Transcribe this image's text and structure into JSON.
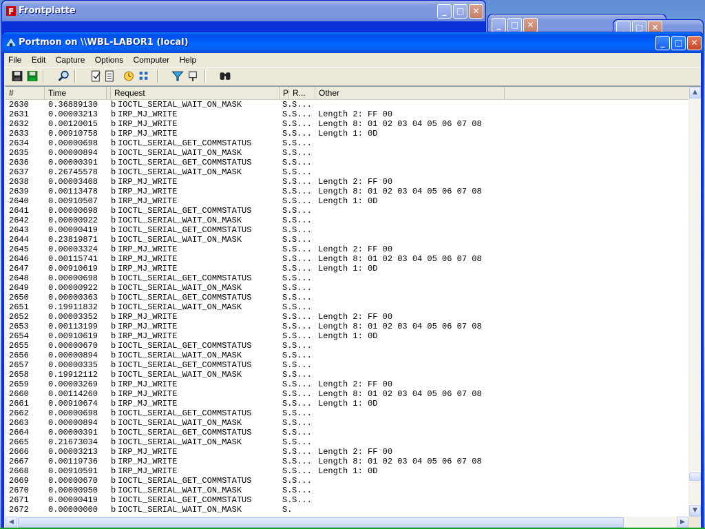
{
  "bg_windows": {
    "frontplatte_title": "Frontplatte"
  },
  "window": {
    "title": "Portmon on \\\\WBL-LABOR1 (local)",
    "minimize": "_",
    "maximize": "□",
    "close": "✕"
  },
  "menu": [
    "File",
    "Edit",
    "Capture",
    "Options",
    "Computer",
    "Help"
  ],
  "columns": [
    "#",
    "Time",
    "Request",
    "P",
    "R...",
    "Other"
  ],
  "colors": {
    "titlebar": "#0058ee",
    "list_bg": "#ffffff",
    "chrome": "#ece9d8"
  },
  "rows": [
    {
      "n": "2630",
      "t": "0.36889130",
      "p": "b",
      "req": "IOCTL_SERIAL_WAIT_ON_MASK",
      "pc": "S.",
      "r": "S...",
      "o": ""
    },
    {
      "n": "2631",
      "t": "0.00003213",
      "p": "b",
      "req": "IRP_MJ_WRITE",
      "pc": "S.",
      "r": "S...",
      "o": "Length 2: FF 00"
    },
    {
      "n": "2632",
      "t": "0.00120015",
      "p": "b",
      "req": "IRP_MJ_WRITE",
      "pc": "S.",
      "r": "S...",
      "o": "Length 8: 01 02 03 04 05 06 07 08"
    },
    {
      "n": "2633",
      "t": "0.00910758",
      "p": "b",
      "req": "IRP_MJ_WRITE",
      "pc": "S.",
      "r": "S...",
      "o": "Length 1: 0D"
    },
    {
      "n": "2634",
      "t": "0.00000698",
      "p": "b",
      "req": "IOCTL_SERIAL_GET_COMMSTATUS",
      "pc": "S.",
      "r": "S...",
      "o": ""
    },
    {
      "n": "2635",
      "t": "0.00000894",
      "p": "b",
      "req": "IOCTL_SERIAL_WAIT_ON_MASK",
      "pc": "S.",
      "r": "S...",
      "o": ""
    },
    {
      "n": "2636",
      "t": "0.00000391",
      "p": "b",
      "req": "IOCTL_SERIAL_GET_COMMSTATUS",
      "pc": "S.",
      "r": "S...",
      "o": ""
    },
    {
      "n": "2637",
      "t": "0.26745578",
      "p": "b",
      "req": "IOCTL_SERIAL_WAIT_ON_MASK",
      "pc": "S.",
      "r": "S...",
      "o": ""
    },
    {
      "n": "2638",
      "t": "0.00003408",
      "p": "b",
      "req": "IRP_MJ_WRITE",
      "pc": "S.",
      "r": "S...",
      "o": "Length 2: FF 00"
    },
    {
      "n": "2639",
      "t": "0.00113478",
      "p": "b",
      "req": "IRP_MJ_WRITE",
      "pc": "S.",
      "r": "S...",
      "o": "Length 8: 01 02 03 04 05 06 07 08"
    },
    {
      "n": "2640",
      "t": "0.00910507",
      "p": "b",
      "req": "IRP_MJ_WRITE",
      "pc": "S.",
      "r": "S...",
      "o": "Length 1: 0D"
    },
    {
      "n": "2641",
      "t": "0.00000698",
      "p": "b",
      "req": "IOCTL_SERIAL_GET_COMMSTATUS",
      "pc": "S.",
      "r": "S...",
      "o": ""
    },
    {
      "n": "2642",
      "t": "0.00000922",
      "p": "b",
      "req": "IOCTL_SERIAL_WAIT_ON_MASK",
      "pc": "S.",
      "r": "S...",
      "o": ""
    },
    {
      "n": "2643",
      "t": "0.00000419",
      "p": "b",
      "req": "IOCTL_SERIAL_GET_COMMSTATUS",
      "pc": "S.",
      "r": "S...",
      "o": ""
    },
    {
      "n": "2644",
      "t": "0.23819871",
      "p": "b",
      "req": "IOCTL_SERIAL_WAIT_ON_MASK",
      "pc": "S.",
      "r": "S...",
      "o": ""
    },
    {
      "n": "2645",
      "t": "0.00003324",
      "p": "b",
      "req": "IRP_MJ_WRITE",
      "pc": "S.",
      "r": "S...",
      "o": "Length 2: FF 00"
    },
    {
      "n": "2646",
      "t": "0.00115741",
      "p": "b",
      "req": "IRP_MJ_WRITE",
      "pc": "S.",
      "r": "S...",
      "o": "Length 8: 01 02 03 04 05 06 07 08"
    },
    {
      "n": "2647",
      "t": "0.00910619",
      "p": "b",
      "req": "IRP_MJ_WRITE",
      "pc": "S.",
      "r": "S...",
      "o": "Length 1: 0D"
    },
    {
      "n": "2648",
      "t": "0.00000698",
      "p": "b",
      "req": "IOCTL_SERIAL_GET_COMMSTATUS",
      "pc": "S.",
      "r": "S...",
      "o": ""
    },
    {
      "n": "2649",
      "t": "0.00000922",
      "p": "b",
      "req": "IOCTL_SERIAL_WAIT_ON_MASK",
      "pc": "S.",
      "r": "S...",
      "o": ""
    },
    {
      "n": "2650",
      "t": "0.00000363",
      "p": "b",
      "req": "IOCTL_SERIAL_GET_COMMSTATUS",
      "pc": "S.",
      "r": "S...",
      "o": ""
    },
    {
      "n": "2651",
      "t": "0.19911832",
      "p": "b",
      "req": "IOCTL_SERIAL_WAIT_ON_MASK",
      "pc": "S.",
      "r": "S...",
      "o": ""
    },
    {
      "n": "2652",
      "t": "0.00003352",
      "p": "b",
      "req": "IRP_MJ_WRITE",
      "pc": "S.",
      "r": "S...",
      "o": "Length 2: FF 00"
    },
    {
      "n": "2653",
      "t": "0.00113199",
      "p": "b",
      "req": "IRP_MJ_WRITE",
      "pc": "S.",
      "r": "S...",
      "o": "Length 8: 01 02 03 04 05 06 07 08"
    },
    {
      "n": "2654",
      "t": "0.00910619",
      "p": "b",
      "req": "IRP_MJ_WRITE",
      "pc": "S.",
      "r": "S...",
      "o": "Length 1: 0D"
    },
    {
      "n": "2655",
      "t": "0.00000670",
      "p": "b",
      "req": "IOCTL_SERIAL_GET_COMMSTATUS",
      "pc": "S.",
      "r": "S...",
      "o": ""
    },
    {
      "n": "2656",
      "t": "0.00000894",
      "p": "b",
      "req": "IOCTL_SERIAL_WAIT_ON_MASK",
      "pc": "S.",
      "r": "S...",
      "o": ""
    },
    {
      "n": "2657",
      "t": "0.00000335",
      "p": "b",
      "req": "IOCTL_SERIAL_GET_COMMSTATUS",
      "pc": "S.",
      "r": "S...",
      "o": ""
    },
    {
      "n": "2658",
      "t": "0.19912112",
      "p": "b",
      "req": "IOCTL_SERIAL_WAIT_ON_MASK",
      "pc": "S.",
      "r": "S...",
      "o": ""
    },
    {
      "n": "2659",
      "t": "0.00003269",
      "p": "b",
      "req": "IRP_MJ_WRITE",
      "pc": "S.",
      "r": "S...",
      "o": "Length 2: FF 00"
    },
    {
      "n": "2660",
      "t": "0.00114260",
      "p": "b",
      "req": "IRP_MJ_WRITE",
      "pc": "S.",
      "r": "S...",
      "o": "Length 8: 01 02 03 04 05 06 07 08"
    },
    {
      "n": "2661",
      "t": "0.00910674",
      "p": "b",
      "req": "IRP_MJ_WRITE",
      "pc": "S.",
      "r": "S...",
      "o": "Length 1: 0D"
    },
    {
      "n": "2662",
      "t": "0.00000698",
      "p": "b",
      "req": "IOCTL_SERIAL_GET_COMMSTATUS",
      "pc": "S.",
      "r": "S...",
      "o": ""
    },
    {
      "n": "2663",
      "t": "0.00000894",
      "p": "b",
      "req": "IOCTL_SERIAL_WAIT_ON_MASK",
      "pc": "S.",
      "r": "S...",
      "o": ""
    },
    {
      "n": "2664",
      "t": "0.00000391",
      "p": "b",
      "req": "IOCTL_SERIAL_GET_COMMSTATUS",
      "pc": "S.",
      "r": "S...",
      "o": ""
    },
    {
      "n": "2665",
      "t": "0.21673034",
      "p": "b",
      "req": "IOCTL_SERIAL_WAIT_ON_MASK",
      "pc": "S.",
      "r": "S...",
      "o": ""
    },
    {
      "n": "2666",
      "t": "0.00003213",
      "p": "b",
      "req": "IRP_MJ_WRITE",
      "pc": "S.",
      "r": "S...",
      "o": "Length 2: FF 00"
    },
    {
      "n": "2667",
      "t": "0.00119736",
      "p": "b",
      "req": "IRP_MJ_WRITE",
      "pc": "S.",
      "r": "S...",
      "o": "Length 8: 01 02 03 04 05 06 07 08"
    },
    {
      "n": "2668",
      "t": "0.00910591",
      "p": "b",
      "req": "IRP_MJ_WRITE",
      "pc": "S.",
      "r": "S...",
      "o": "Length 1: 0D"
    },
    {
      "n": "2669",
      "t": "0.00000670",
      "p": "b",
      "req": "IOCTL_SERIAL_GET_COMMSTATUS",
      "pc": "S.",
      "r": "S...",
      "o": ""
    },
    {
      "n": "2670",
      "t": "0.00000950",
      "p": "b",
      "req": "IOCTL_SERIAL_WAIT_ON_MASK",
      "pc": "S.",
      "r": "S...",
      "o": ""
    },
    {
      "n": "2671",
      "t": "0.00000419",
      "p": "b",
      "req": "IOCTL_SERIAL_GET_COMMSTATUS",
      "pc": "S.",
      "r": "S...",
      "o": ""
    },
    {
      "n": "2672",
      "t": "0.00000000",
      "p": "b",
      "req": "IOCTL_SERIAL_WAIT_ON_MASK",
      "pc": "S.",
      "r": "",
      "o": ""
    }
  ]
}
